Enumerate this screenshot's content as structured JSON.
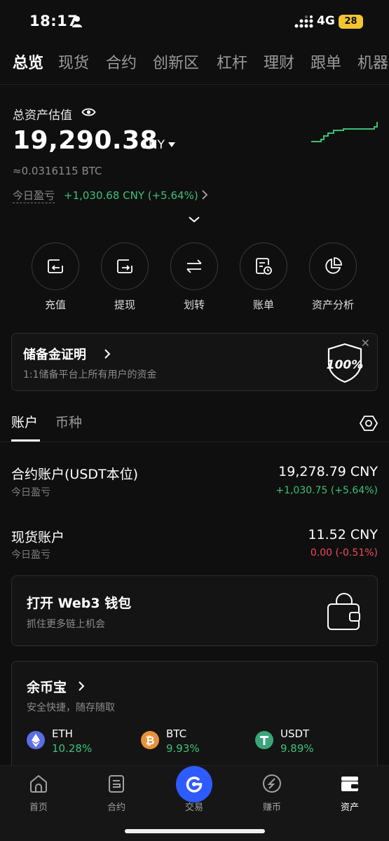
{
  "status": {
    "time": "18:17",
    "network": "4G",
    "battery": "28"
  },
  "tabs": [
    "总览",
    "现货",
    "合约",
    "创新区",
    "杠杆",
    "理财",
    "跟单",
    "机器"
  ],
  "summary": {
    "label": "总资产估值",
    "value": "19,290.38",
    "unit": "CNY",
    "btc": "≈0.0316115 BTC",
    "pnl_label": "今日盈亏",
    "pnl_value": "+1,030.68 CNY (+5.64%)"
  },
  "actions": [
    {
      "label": "充值",
      "icon": "deposit-icon"
    },
    {
      "label": "提现",
      "icon": "withdraw-icon"
    },
    {
      "label": "划转",
      "icon": "transfer-icon"
    },
    {
      "label": "账单",
      "icon": "bill-icon"
    },
    {
      "label": "资产分析",
      "icon": "pie-chart-icon"
    }
  ],
  "proof": {
    "title": "储备金证明",
    "subtitle": "1:1储备平台上所有用户的资金",
    "badge": "100%"
  },
  "account_tabs": [
    "账户",
    "币种"
  ],
  "accounts": [
    {
      "name": "合约账户(USDT本位)",
      "sub": "今日盈亏",
      "value": "19,278.79 CNY",
      "pnl": "+1,030.75 (+5.64%)",
      "pnl_color": "#3cc07a"
    },
    {
      "name": "现货账户",
      "sub": "今日盈亏",
      "value": "11.52 CNY",
      "pnl": "0.00 (-0.51%)",
      "pnl_color": "#f0495c"
    }
  ],
  "web3": {
    "title": "打开 Web3 钱包",
    "subtitle": "抓住更多链上机会"
  },
  "earn": {
    "title": "余币宝",
    "subtitle": "安全快捷，随存随取",
    "coins": [
      {
        "name": "ETH",
        "rate": "10.28%",
        "color": "#5b6ee6"
      },
      {
        "name": "BTC",
        "rate": "9.93%",
        "color": "#e8923a"
      },
      {
        "name": "USDT",
        "rate": "9.89%",
        "color": "#3aa57a"
      }
    ]
  },
  "bottom_nav": [
    {
      "label": "首页",
      "icon": "home-icon"
    },
    {
      "label": "合约",
      "icon": "contract-icon"
    },
    {
      "label": "交易",
      "icon": "trade-icon"
    },
    {
      "label": "赚币",
      "icon": "earn-icon"
    },
    {
      "label": "资产",
      "icon": "wallet-icon"
    }
  ],
  "colors": {
    "accent": "#2e5bff",
    "gain": "#3cc07a",
    "loss": "#f0495c"
  }
}
